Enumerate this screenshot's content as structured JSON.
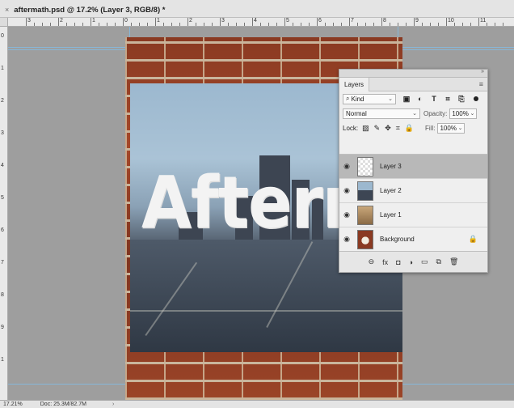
{
  "tab": {
    "close_icon": "×",
    "title": "aftermath.psd @ 17.2% (Layer 3, RGB/8) *"
  },
  "ruler": {
    "h_numbers": [
      "3",
      "2",
      "1",
      "0",
      "1",
      "2",
      "3",
      "4",
      "5",
      "6",
      "7",
      "8",
      "9",
      "10",
      "11"
    ],
    "v_numbers": [
      "0",
      "1",
      "2",
      "3",
      "4",
      "5",
      "6",
      "7",
      "8",
      "9",
      "1"
    ]
  },
  "document": {
    "headline_text": "Afterma"
  },
  "layers_panel": {
    "tab_label": "Layers",
    "kind_label": "Kind",
    "blend_mode": "Normal",
    "opacity_label": "Opacity:",
    "opacity_value": "100%",
    "lock_label": "Lock:",
    "fill_label": "Fill:",
    "fill_value": "100%",
    "layers": [
      {
        "name": "Layer 3",
        "selected": true
      },
      {
        "name": "Layer 2",
        "selected": false
      },
      {
        "name": "Layer 1",
        "selected": false
      },
      {
        "name": "Background",
        "selected": false,
        "locked": true
      }
    ],
    "footer_icons": [
      "link-icon",
      "fx-icon",
      "mask-icon",
      "adjustment-icon",
      "folder-icon",
      "new-layer-icon",
      "trash-icon"
    ],
    "fx_label": "fx"
  },
  "status": {
    "zoom": "17.21%",
    "doc_size": "Doc: 25.3M/82.7M"
  },
  "colors": {
    "brick": "#9b4427",
    "sky": "#9cb8cf",
    "panel_bg": "#efefef",
    "selected_row": "#b8b8b8"
  }
}
